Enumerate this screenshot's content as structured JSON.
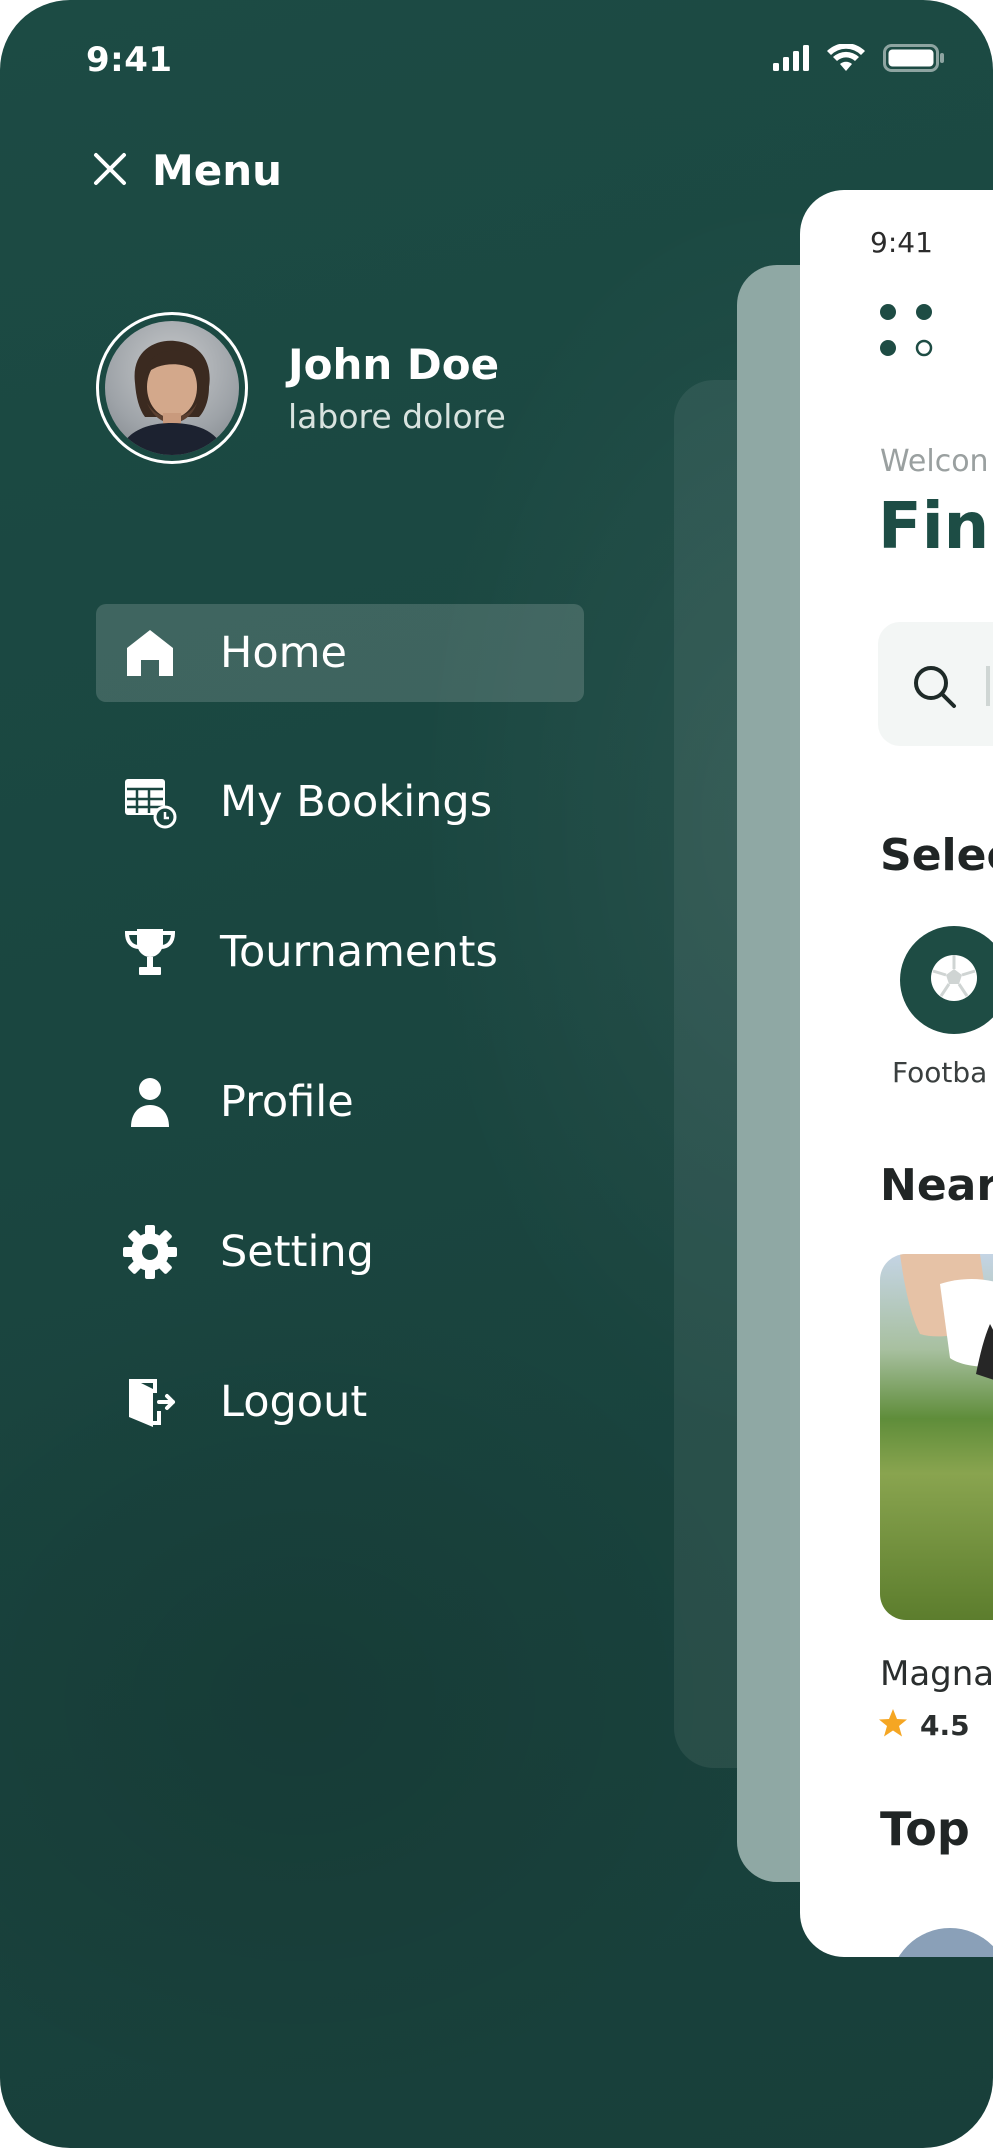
{
  "status_bar": {
    "time": "9:41"
  },
  "menu": {
    "title": "Menu"
  },
  "user": {
    "name": "John Doe",
    "subtitle": "labore dolore"
  },
  "nav": {
    "items": [
      {
        "label": "Home",
        "icon": "home-icon",
        "active": true
      },
      {
        "label": "My Bookings",
        "icon": "calendar-clock-icon",
        "active": false
      },
      {
        "label": "Tournaments",
        "icon": "trophy-icon",
        "active": false
      },
      {
        "label": "Profile",
        "icon": "person-icon",
        "active": false
      },
      {
        "label": "Setting",
        "icon": "gear-icon",
        "active": false
      },
      {
        "label": "Logout",
        "icon": "logout-icon",
        "active": false
      }
    ]
  },
  "preview": {
    "time": "9:41",
    "welcome": "Welcon",
    "heading": "Fin",
    "select_heading": "Selec",
    "category_label": "Footba",
    "nearby_heading": "Near",
    "venue_name": "Magna",
    "venue_rating": "4.5",
    "top_heading": "Top"
  },
  "colors": {
    "background": "#1a4640",
    "accent": "#1e4c44",
    "active_item_bg": "rgba(255,255,255,0.16)",
    "star": "#f5a623"
  }
}
